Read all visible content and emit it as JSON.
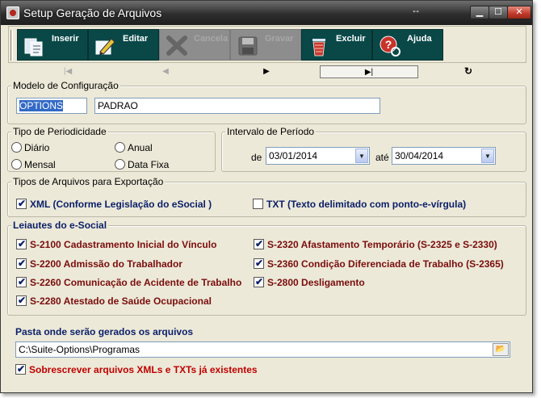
{
  "window": {
    "title": "Setup Geração de Arquivos",
    "resize_glyph": "↔",
    "min_glyph": "▁",
    "max_glyph": "☐",
    "close_glyph": "✕"
  },
  "toolbar": {
    "inserir": "Inserir",
    "editar": "Editar",
    "cancela": "Cancela",
    "gravar": "Gravar",
    "excluir": "Excluir",
    "ajuda": "Ajuda"
  },
  "navigator": {
    "first": "|◀",
    "prior": "◀",
    "next": "▶",
    "last": "▶|",
    "refresh": "↻"
  },
  "modelo": {
    "title": "Modelo de Configuração",
    "code": "OPTIONS",
    "name": "PADRAO"
  },
  "periodicidade": {
    "title": "Tipo de Periodicidade",
    "options": [
      "Diário",
      "Anual",
      "Mensal",
      "Data Fixa"
    ]
  },
  "intervalo": {
    "title": "Intervalo de Período",
    "de_label": "de",
    "de_value": "03/01/2014",
    "ate_label": "até",
    "ate_value": "30/04/2014"
  },
  "tipos": {
    "title": "Tipos de Arquivos para Exportação",
    "xml": {
      "label": "XML (Conforme Legislação do eSocial )",
      "checked": true
    },
    "txt": {
      "label": "TXT (Texto delimitado com ponto-e-vírgula)",
      "checked": false
    }
  },
  "leiautes": {
    "title": "Leiautes do e-Social",
    "items": [
      {
        "label": "S-2100 Cadastramento Inicial do Vínculo",
        "checked": true
      },
      {
        "label": "S-2200 Admissão do Trabalhador",
        "checked": true
      },
      {
        "label": "S-2260 Comunicação de Acidente de Trabalho",
        "checked": true
      },
      {
        "label": "S-2280 Atestado de Saúde Ocupacional",
        "checked": true
      },
      {
        "label": "S-2320 Afastamento Temporário (S-2325 e S-2330)",
        "checked": true
      },
      {
        "label": "S-2360 Condição Diferenciada de Trabalho (S-2365)",
        "checked": true
      },
      {
        "label": "S-2800 Desligamento",
        "checked": true
      }
    ]
  },
  "pasta": {
    "title": "Pasta onde serão gerados os arquivos",
    "path": "C:\\Suite-Options\\Programas",
    "overwrite": {
      "label": "Sobrescrever arquivos XMLs e TXTs já existentes",
      "checked": true
    }
  },
  "colors": {
    "toolbar_button": "#0a4848",
    "checkbox_text_blue": "#0b1f6a",
    "checkbox_text_maroon": "#7a0d0d",
    "overwrite_text": "#c00000"
  }
}
